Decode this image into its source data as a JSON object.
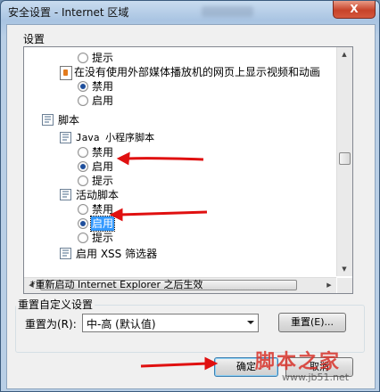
{
  "window": {
    "title": "安全设置 - Internet 区域",
    "close_label": "X"
  },
  "settings_label": "设置",
  "tree": {
    "opt_prompt_top": "提示",
    "media_item": "在没有使用外部媒体播放机的网页上显示视频和动画",
    "media_disable": "禁用",
    "media_enable": "启用",
    "scripting": "脚本",
    "java_applet": "Java 小程序脚本",
    "java_disable": "禁用",
    "java_enable": "启用",
    "java_prompt": "提示",
    "active_scripting": "活动脚本",
    "active_disable": "禁用",
    "active_enable": "启用",
    "active_prompt": "提示",
    "xss_filter": "启用 XSS 筛选器"
  },
  "note": "*重新启动 Internet Explorer 之后生效",
  "reset_group": {
    "title": "重置自定义设置",
    "reset_to_label": "重置为(R):",
    "level_value": "中-高 (默认值)",
    "reset_button": "重置(E)..."
  },
  "footer": {
    "ok_button": "确定",
    "cancel_button": "取消"
  },
  "watermark": {
    "brand": "脚本之家",
    "url": "www.jb51.net"
  },
  "colors": {
    "annotation_arrow": "#e01010",
    "selection": "#3399ff"
  }
}
